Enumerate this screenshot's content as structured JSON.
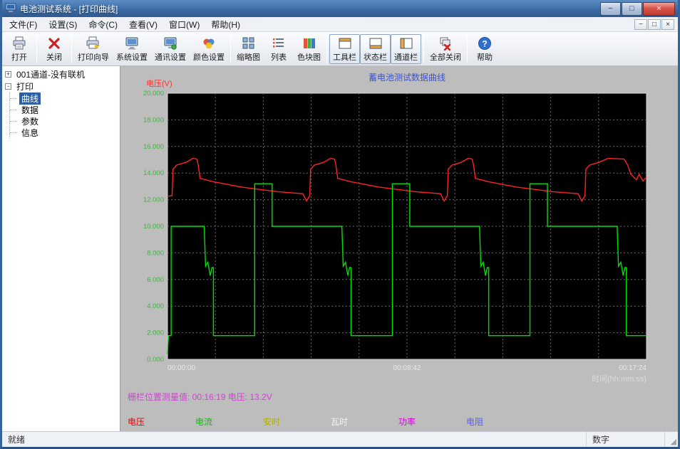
{
  "window": {
    "title": "电池测试系统 - [打印曲线]",
    "buttons": {
      "minimize": "−",
      "maximize": "□",
      "close": "×"
    }
  },
  "mdi": {
    "minimize": "−",
    "restore": "□",
    "close": "×"
  },
  "menu": {
    "items": [
      {
        "name": "file",
        "label": "文件(F)"
      },
      {
        "name": "settings",
        "label": "设置(S)"
      },
      {
        "name": "command",
        "label": "命令(C)"
      },
      {
        "name": "view",
        "label": "查看(V)"
      },
      {
        "name": "window",
        "label": "窗口(W)"
      },
      {
        "name": "help",
        "label": "帮助(H)"
      }
    ]
  },
  "toolbar": {
    "items": [
      {
        "type": "button",
        "name": "open",
        "label": "打开",
        "icon": "printer-page-icon"
      },
      {
        "type": "separator"
      },
      {
        "type": "button",
        "name": "close",
        "label": "关闭",
        "icon": "red-x-icon"
      },
      {
        "type": "separator"
      },
      {
        "type": "button",
        "name": "print-wizard",
        "label": "打印向导",
        "icon": "printer-wizard-icon"
      },
      {
        "type": "button",
        "name": "system-settings",
        "label": "系统设置",
        "icon": "monitor-icon"
      },
      {
        "type": "button",
        "name": "comm-settings",
        "label": "通讯设置",
        "icon": "monitor-link-icon"
      },
      {
        "type": "button",
        "name": "color-settings",
        "label": "颜色设置",
        "icon": "palette-icon"
      },
      {
        "type": "separator"
      },
      {
        "type": "button",
        "name": "thumbnail",
        "label": "缩略图",
        "icon": "grid-icon"
      },
      {
        "type": "button",
        "name": "list",
        "label": "列表",
        "icon": "list-icon"
      },
      {
        "type": "button",
        "name": "color-block",
        "label": "色块图",
        "icon": "color-blocks-icon"
      },
      {
        "type": "separator"
      },
      {
        "type": "button",
        "name": "toolbar-toggle",
        "label": "工具栏",
        "icon": "toolbar-icon",
        "toggled": true
      },
      {
        "type": "button",
        "name": "statusbar-toggle",
        "label": "状态栏",
        "icon": "statusbar-icon",
        "toggled": true
      },
      {
        "type": "button",
        "name": "channelbar-toggle",
        "label": "通道栏",
        "icon": "channelbar-icon",
        "toggled": true
      },
      {
        "type": "separator"
      },
      {
        "type": "button",
        "name": "close-all",
        "label": "全部关闭",
        "icon": "close-all-icon"
      },
      {
        "type": "separator"
      },
      {
        "type": "button",
        "name": "help",
        "label": "帮助",
        "icon": "help-icon"
      }
    ]
  },
  "tree": {
    "nodes": [
      {
        "name": "channel-001",
        "label": "001通道-没有联机",
        "expander": "+",
        "children": []
      },
      {
        "name": "print",
        "label": "打印",
        "expander": "-",
        "children": [
          {
            "name": "curve",
            "label": "曲线",
            "selected": true
          },
          {
            "name": "data",
            "label": "数据"
          },
          {
            "name": "params",
            "label": "参数"
          },
          {
            "name": "info",
            "label": "信息"
          }
        ]
      }
    ]
  },
  "chart_data": {
    "type": "line",
    "title": "蓄电池测试数据曲线",
    "title_color": "#3a50d9",
    "ylabel": "电压(V)",
    "xlabel": "时间(hh:mm:ss)",
    "ylim": [
      0,
      20
    ],
    "ytick_step": 2,
    "ytick_color": "#3db53d",
    "xtick_color": "#e9e9e9",
    "axis_label_colors": {
      "y": "#ff3030",
      "x": "#dcdcdc"
    },
    "plot_bg": "#000000",
    "plot_border": "#d9d9d9",
    "grid_color": "#6a6a6a",
    "grid_on": true,
    "x_divisions": 10,
    "xlim_seconds": [
      0,
      1044
    ],
    "xticks": [
      {
        "t": 0,
        "label": "00:00:00"
      },
      {
        "t": 522,
        "label": "00:08:42"
      },
      {
        "t": 1044,
        "label": "00:17:24"
      }
    ],
    "series": [
      {
        "name": "电压",
        "name_en": "voltage",
        "color": "#ff2222",
        "points": [
          [
            0,
            12.25
          ],
          [
            10,
            12.3
          ],
          [
            12,
            14.3
          ],
          [
            20,
            14.6
          ],
          [
            40,
            14.8
          ],
          [
            55,
            15.1
          ],
          [
            64,
            15.05
          ],
          [
            67,
            14.6
          ],
          [
            71,
            13.6
          ],
          [
            100,
            13.35
          ],
          [
            160,
            12.95
          ],
          [
            240,
            12.6
          ],
          [
            295,
            12.45
          ],
          [
            303,
            11.9
          ],
          [
            310,
            12.3
          ],
          [
            312,
            14.3
          ],
          [
            320,
            14.6
          ],
          [
            340,
            14.8
          ],
          [
            355,
            15.1
          ],
          [
            364,
            15.05
          ],
          [
            367,
            14.6
          ],
          [
            371,
            13.6
          ],
          [
            400,
            13.35
          ],
          [
            460,
            12.95
          ],
          [
            540,
            12.6
          ],
          [
            595,
            12.45
          ],
          [
            603,
            11.9
          ],
          [
            610,
            12.3
          ],
          [
            612,
            14.3
          ],
          [
            620,
            14.6
          ],
          [
            640,
            14.8
          ],
          [
            655,
            15.1
          ],
          [
            664,
            15.05
          ],
          [
            667,
            14.6
          ],
          [
            671,
            13.6
          ],
          [
            700,
            13.35
          ],
          [
            760,
            12.95
          ],
          [
            840,
            12.6
          ],
          [
            895,
            12.45
          ],
          [
            903,
            11.9
          ],
          [
            910,
            12.3
          ],
          [
            912,
            14.3
          ],
          [
            920,
            14.6
          ],
          [
            940,
            14.8
          ],
          [
            960,
            15.1
          ],
          [
            995,
            15.05
          ],
          [
            1003,
            14.6
          ],
          [
            1010,
            13.9
          ],
          [
            1022,
            13.5
          ],
          [
            1028,
            13.9
          ],
          [
            1036,
            13.4
          ],
          [
            1044,
            13.7
          ]
        ]
      },
      {
        "name": "电流",
        "name_en": "current",
        "color": "#00e000",
        "points": [
          [
            0,
            0.4
          ],
          [
            2,
            1.78
          ],
          [
            8,
            1.78
          ],
          [
            8,
            10
          ],
          [
            80,
            10
          ],
          [
            83,
            7.0
          ],
          [
            88,
            7.3
          ],
          [
            93,
            6.3
          ],
          [
            97,
            6.9
          ],
          [
            100,
            6.9
          ],
          [
            100,
            1.78
          ],
          [
            190,
            1.78
          ],
          [
            190,
            13.2
          ],
          [
            228,
            13.2
          ],
          [
            228,
            10
          ],
          [
            380,
            10
          ],
          [
            383,
            7.0
          ],
          [
            388,
            7.3
          ],
          [
            393,
            6.3
          ],
          [
            397,
            6.9
          ],
          [
            400,
            6.9
          ],
          [
            400,
            1.78
          ],
          [
            490,
            1.78
          ],
          [
            490,
            13.2
          ],
          [
            528,
            13.2
          ],
          [
            528,
            10
          ],
          [
            680,
            10
          ],
          [
            683,
            7.0
          ],
          [
            688,
            7.3
          ],
          [
            693,
            6.3
          ],
          [
            697,
            6.9
          ],
          [
            700,
            6.9
          ],
          [
            700,
            1.78
          ],
          [
            790,
            1.78
          ],
          [
            790,
            13.2
          ],
          [
            828,
            13.2
          ],
          [
            828,
            10
          ],
          [
            980,
            10
          ],
          [
            983,
            7.0
          ],
          [
            988,
            7.3
          ],
          [
            993,
            6.3
          ],
          [
            997,
            6.9
          ],
          [
            1000,
            6.9
          ],
          [
            1000,
            1.78
          ],
          [
            1044,
            1.78
          ]
        ]
      }
    ],
    "legend": [
      {
        "name": "voltage",
        "label": "电压",
        "color": "#e80000"
      },
      {
        "name": "current",
        "label": "电流",
        "color": "#00c400"
      },
      {
        "name": "amp-hours",
        "label": "安时",
        "color": "#b0b000"
      },
      {
        "name": "watt-hours",
        "label": "瓦时",
        "color": "#f4f4f4"
      },
      {
        "name": "power",
        "label": "功率",
        "color": "#d400d4"
      },
      {
        "name": "resistance",
        "label": "电阻",
        "color": "#5a5aff"
      }
    ],
    "legend_position": "bottom"
  },
  "footer": {
    "measurement": "栅栏位置测量值: 00:16:19  电压: 13.2V"
  },
  "statusbar": {
    "left": "就绪",
    "right": "数字"
  }
}
